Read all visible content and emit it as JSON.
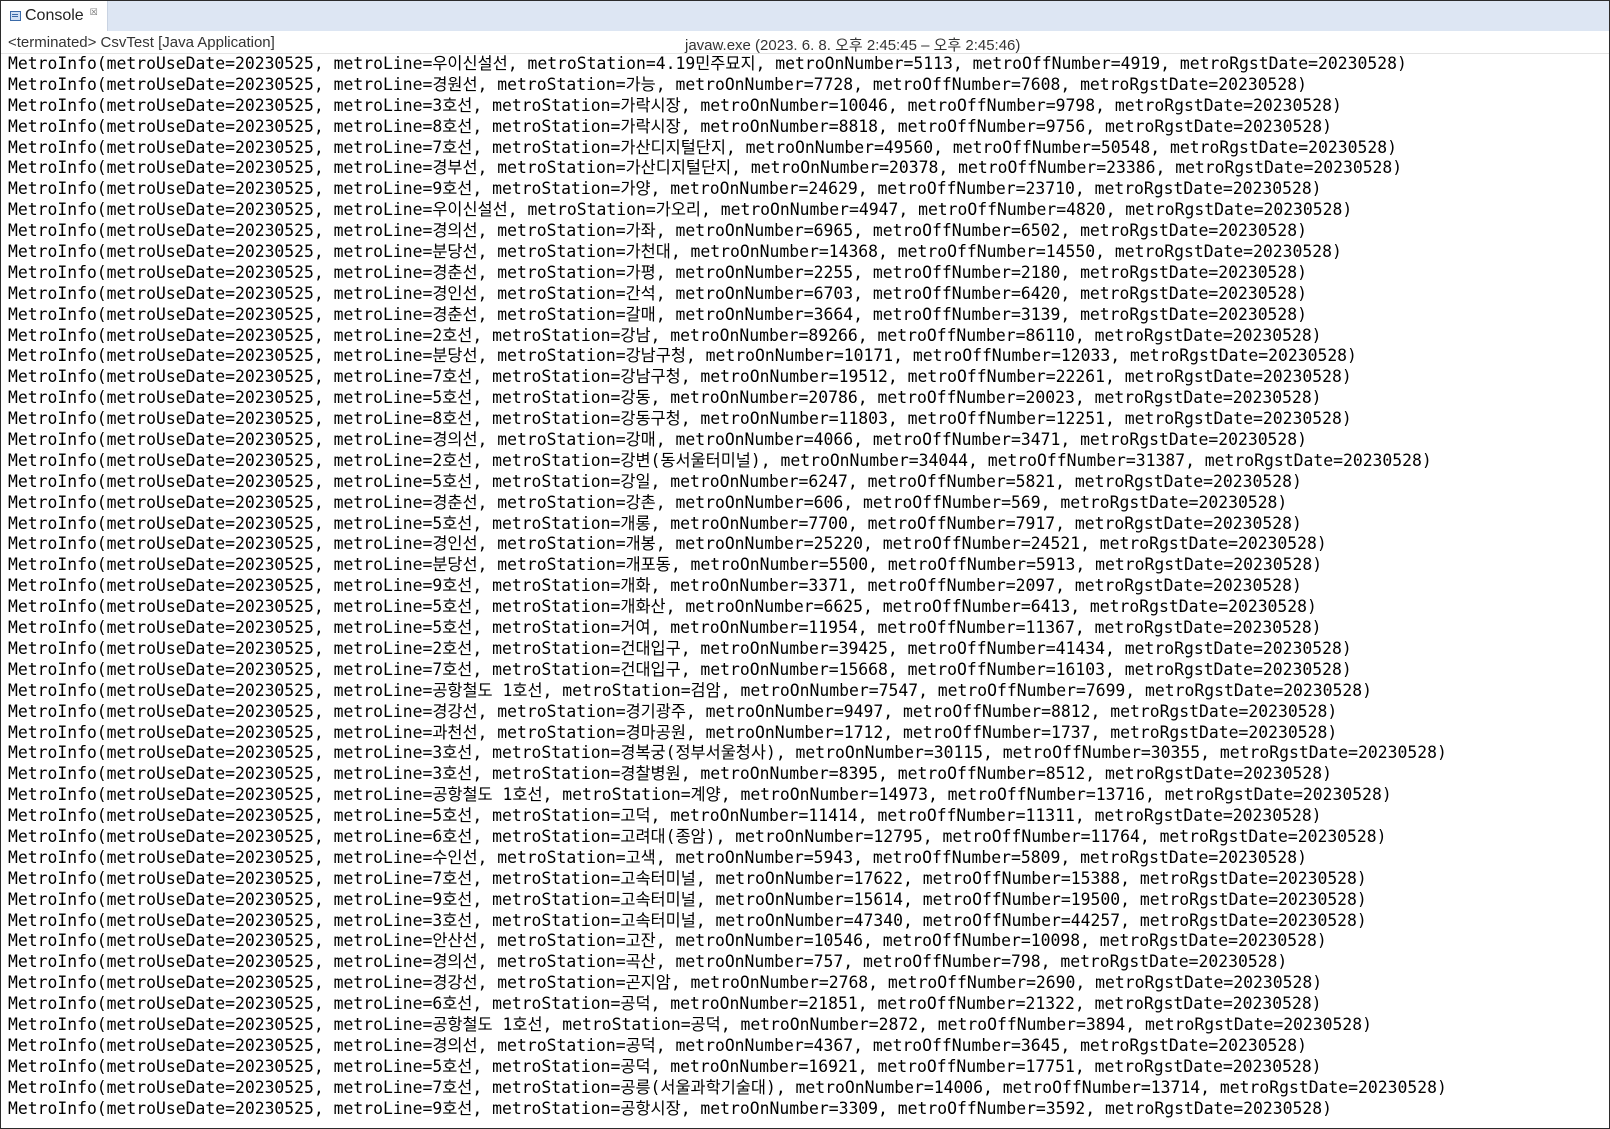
{
  "tab": {
    "label": "Console",
    "close": "☒"
  },
  "status": {
    "left": "<terminated> CsvTest [Java Application]",
    "right": "javaw.exe  (2023. 6. 8. 오후 2:45:45 – 오후 2:45:46)"
  },
  "lines": [
    "MetroInfo(metroUseDate=20230525, metroLine=우이신설선, metroStation=4.19민주묘지, metroOnNumber=5113, metroOffNumber=4919, metroRgstDate=20230528)",
    "MetroInfo(metroUseDate=20230525, metroLine=경원선, metroStation=가능, metroOnNumber=7728, metroOffNumber=7608, metroRgstDate=20230528)",
    "MetroInfo(metroUseDate=20230525, metroLine=3호선, metroStation=가락시장, metroOnNumber=10046, metroOffNumber=9798, metroRgstDate=20230528)",
    "MetroInfo(metroUseDate=20230525, metroLine=8호선, metroStation=가락시장, metroOnNumber=8818, metroOffNumber=9756, metroRgstDate=20230528)",
    "MetroInfo(metroUseDate=20230525, metroLine=7호선, metroStation=가산디지털단지, metroOnNumber=49560, metroOffNumber=50548, metroRgstDate=20230528)",
    "MetroInfo(metroUseDate=20230525, metroLine=경부선, metroStation=가산디지털단지, metroOnNumber=20378, metroOffNumber=23386, metroRgstDate=20230528)",
    "MetroInfo(metroUseDate=20230525, metroLine=9호선, metroStation=가양, metroOnNumber=24629, metroOffNumber=23710, metroRgstDate=20230528)",
    "MetroInfo(metroUseDate=20230525, metroLine=우이신설선, metroStation=가오리, metroOnNumber=4947, metroOffNumber=4820, metroRgstDate=20230528)",
    "MetroInfo(metroUseDate=20230525, metroLine=경의선, metroStation=가좌, metroOnNumber=6965, metroOffNumber=6502, metroRgstDate=20230528)",
    "MetroInfo(metroUseDate=20230525, metroLine=분당선, metroStation=가천대, metroOnNumber=14368, metroOffNumber=14550, metroRgstDate=20230528)",
    "MetroInfo(metroUseDate=20230525, metroLine=경춘선, metroStation=가평, metroOnNumber=2255, metroOffNumber=2180, metroRgstDate=20230528)",
    "MetroInfo(metroUseDate=20230525, metroLine=경인선, metroStation=간석, metroOnNumber=6703, metroOffNumber=6420, metroRgstDate=20230528)",
    "MetroInfo(metroUseDate=20230525, metroLine=경춘선, metroStation=갈매, metroOnNumber=3664, metroOffNumber=3139, metroRgstDate=20230528)",
    "MetroInfo(metroUseDate=20230525, metroLine=2호선, metroStation=강남, metroOnNumber=89266, metroOffNumber=86110, metroRgstDate=20230528)",
    "MetroInfo(metroUseDate=20230525, metroLine=분당선, metroStation=강남구청, metroOnNumber=10171, metroOffNumber=12033, metroRgstDate=20230528)",
    "MetroInfo(metroUseDate=20230525, metroLine=7호선, metroStation=강남구청, metroOnNumber=19512, metroOffNumber=22261, metroRgstDate=20230528)",
    "MetroInfo(metroUseDate=20230525, metroLine=5호선, metroStation=강동, metroOnNumber=20786, metroOffNumber=20023, metroRgstDate=20230528)",
    "MetroInfo(metroUseDate=20230525, metroLine=8호선, metroStation=강동구청, metroOnNumber=11803, metroOffNumber=12251, metroRgstDate=20230528)",
    "MetroInfo(metroUseDate=20230525, metroLine=경의선, metroStation=강매, metroOnNumber=4066, metroOffNumber=3471, metroRgstDate=20230528)",
    "MetroInfo(metroUseDate=20230525, metroLine=2호선, metroStation=강변(동서울터미널), metroOnNumber=34044, metroOffNumber=31387, metroRgstDate=20230528)",
    "MetroInfo(metroUseDate=20230525, metroLine=5호선, metroStation=강일, metroOnNumber=6247, metroOffNumber=5821, metroRgstDate=20230528)",
    "MetroInfo(metroUseDate=20230525, metroLine=경춘선, metroStation=강촌, metroOnNumber=606, metroOffNumber=569, metroRgstDate=20230528)",
    "MetroInfo(metroUseDate=20230525, metroLine=5호선, metroStation=개롱, metroOnNumber=7700, metroOffNumber=7917, metroRgstDate=20230528)",
    "MetroInfo(metroUseDate=20230525, metroLine=경인선, metroStation=개봉, metroOnNumber=25220, metroOffNumber=24521, metroRgstDate=20230528)",
    "MetroInfo(metroUseDate=20230525, metroLine=분당선, metroStation=개포동, metroOnNumber=5500, metroOffNumber=5913, metroRgstDate=20230528)",
    "MetroInfo(metroUseDate=20230525, metroLine=9호선, metroStation=개화, metroOnNumber=3371, metroOffNumber=2097, metroRgstDate=20230528)",
    "MetroInfo(metroUseDate=20230525, metroLine=5호선, metroStation=개화산, metroOnNumber=6625, metroOffNumber=6413, metroRgstDate=20230528)",
    "MetroInfo(metroUseDate=20230525, metroLine=5호선, metroStation=거여, metroOnNumber=11954, metroOffNumber=11367, metroRgstDate=20230528)",
    "MetroInfo(metroUseDate=20230525, metroLine=2호선, metroStation=건대입구, metroOnNumber=39425, metroOffNumber=41434, metroRgstDate=20230528)",
    "MetroInfo(metroUseDate=20230525, metroLine=7호선, metroStation=건대입구, metroOnNumber=15668, metroOffNumber=16103, metroRgstDate=20230528)",
    "MetroInfo(metroUseDate=20230525, metroLine=공항철도 1호선, metroStation=검암, metroOnNumber=7547, metroOffNumber=7699, metroRgstDate=20230528)",
    "MetroInfo(metroUseDate=20230525, metroLine=경강선, metroStation=경기광주, metroOnNumber=9497, metroOffNumber=8812, metroRgstDate=20230528)",
    "MetroInfo(metroUseDate=20230525, metroLine=과천선, metroStation=경마공원, metroOnNumber=1712, metroOffNumber=1737, metroRgstDate=20230528)",
    "MetroInfo(metroUseDate=20230525, metroLine=3호선, metroStation=경복궁(정부서울청사), metroOnNumber=30115, metroOffNumber=30355, metroRgstDate=20230528)",
    "MetroInfo(metroUseDate=20230525, metroLine=3호선, metroStation=경찰병원, metroOnNumber=8395, metroOffNumber=8512, metroRgstDate=20230528)",
    "MetroInfo(metroUseDate=20230525, metroLine=공항철도 1호선, metroStation=계양, metroOnNumber=14973, metroOffNumber=13716, metroRgstDate=20230528)",
    "MetroInfo(metroUseDate=20230525, metroLine=5호선, metroStation=고덕, metroOnNumber=11414, metroOffNumber=11311, metroRgstDate=20230528)",
    "MetroInfo(metroUseDate=20230525, metroLine=6호선, metroStation=고려대(종암), metroOnNumber=12795, metroOffNumber=11764, metroRgstDate=20230528)",
    "MetroInfo(metroUseDate=20230525, metroLine=수인선, metroStation=고색, metroOnNumber=5943, metroOffNumber=5809, metroRgstDate=20230528)",
    "MetroInfo(metroUseDate=20230525, metroLine=7호선, metroStation=고속터미널, metroOnNumber=17622, metroOffNumber=15388, metroRgstDate=20230528)",
    "MetroInfo(metroUseDate=20230525, metroLine=9호선, metroStation=고속터미널, metroOnNumber=15614, metroOffNumber=19500, metroRgstDate=20230528)",
    "MetroInfo(metroUseDate=20230525, metroLine=3호선, metroStation=고속터미널, metroOnNumber=47340, metroOffNumber=44257, metroRgstDate=20230528)",
    "MetroInfo(metroUseDate=20230525, metroLine=안산선, metroStation=고잔, metroOnNumber=10546, metroOffNumber=10098, metroRgstDate=20230528)",
    "MetroInfo(metroUseDate=20230525, metroLine=경의선, metroStation=곡산, metroOnNumber=757, metroOffNumber=798, metroRgstDate=20230528)",
    "MetroInfo(metroUseDate=20230525, metroLine=경강선, metroStation=곤지암, metroOnNumber=2768, metroOffNumber=2690, metroRgstDate=20230528)",
    "MetroInfo(metroUseDate=20230525, metroLine=6호선, metroStation=공덕, metroOnNumber=21851, metroOffNumber=21322, metroRgstDate=20230528)",
    "MetroInfo(metroUseDate=20230525, metroLine=공항철도 1호선, metroStation=공덕, metroOnNumber=2872, metroOffNumber=3894, metroRgstDate=20230528)",
    "MetroInfo(metroUseDate=20230525, metroLine=경의선, metroStation=공덕, metroOnNumber=4367, metroOffNumber=3645, metroRgstDate=20230528)",
    "MetroInfo(metroUseDate=20230525, metroLine=5호선, metroStation=공덕, metroOnNumber=16921, metroOffNumber=17751, metroRgstDate=20230528)",
    "MetroInfo(metroUseDate=20230525, metroLine=7호선, metroStation=공릉(서울과학기술대), metroOnNumber=14006, metroOffNumber=13714, metroRgstDate=20230528)",
    "MetroInfo(metroUseDate=20230525, metroLine=9호선, metroStation=공항시장, metroOnNumber=3309, metroOffNumber=3592, metroRgstDate=20230528)"
  ]
}
